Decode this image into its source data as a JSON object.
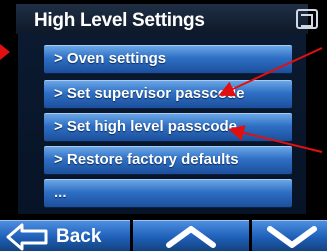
{
  "header": {
    "title": "High Level Settings"
  },
  "menu": {
    "items": [
      {
        "label": "> Oven settings"
      },
      {
        "label": "> Set supervisor passcode"
      },
      {
        "label": "> Set high level passcode"
      },
      {
        "label": "> Restore factory defaults"
      },
      {
        "label": "..."
      }
    ]
  },
  "footer": {
    "back_label": "Back"
  },
  "colors": {
    "accent": "#2e6fc4",
    "annotation": "#e01010"
  }
}
